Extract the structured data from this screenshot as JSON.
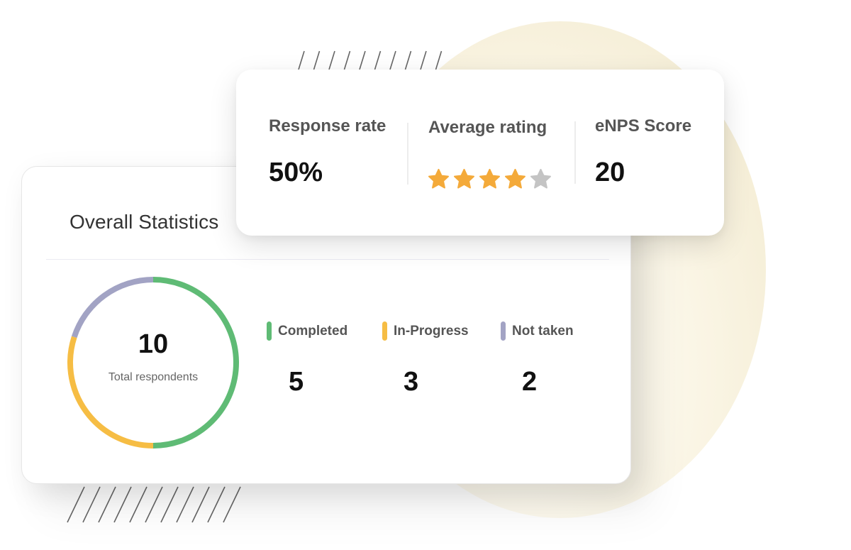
{
  "kpis": [
    {
      "label": "Response rate",
      "value": "50%"
    },
    {
      "label": "Average rating",
      "rating": 4,
      "rating_max": 5
    },
    {
      "label": "eNPS Score",
      "value": "20"
    }
  ],
  "overall": {
    "title": "Overall Statistics",
    "total": "10",
    "total_label": "Total respondents",
    "segments": [
      {
        "label": "Completed",
        "value": "5",
        "count": 5,
        "color": "#5fbb75"
      },
      {
        "label": "In-Progress",
        "value": "3",
        "count": 3,
        "color": "#f6bd44"
      },
      {
        "label": "Not taken",
        "value": "2",
        "count": 2,
        "color": "#a2a3c4"
      }
    ]
  },
  "colors": {
    "star_filled": "#f4aa3a",
    "star_empty": "#c4c4c4"
  }
}
